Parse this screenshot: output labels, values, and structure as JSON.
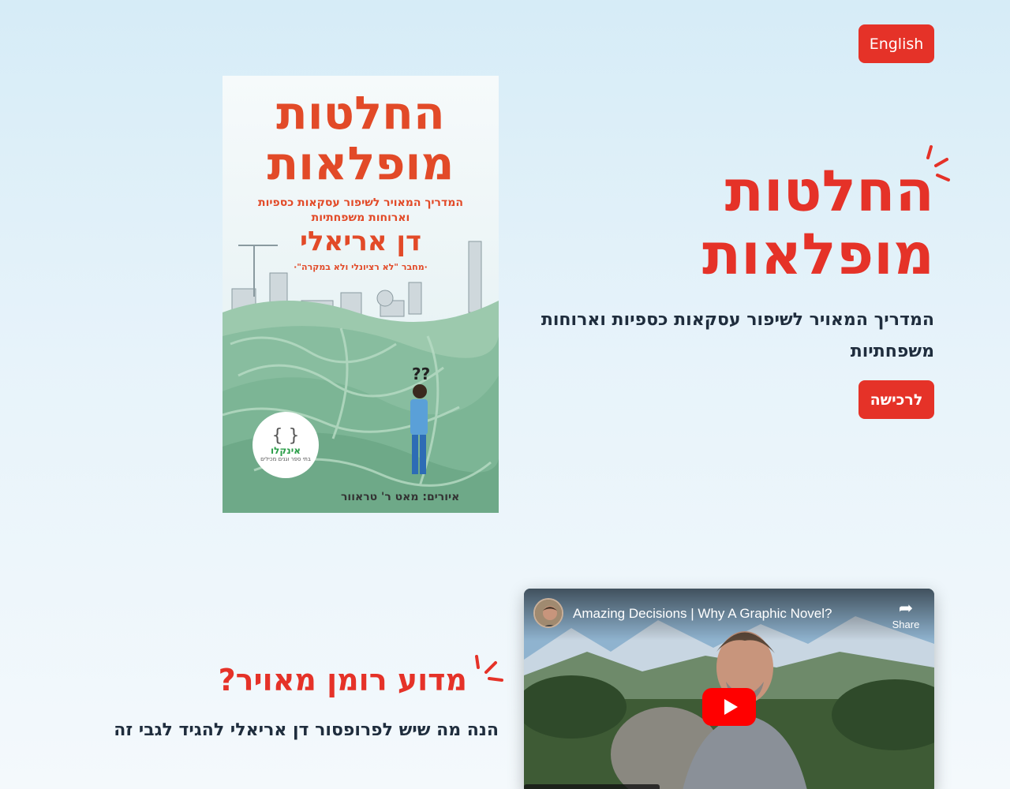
{
  "header": {
    "language_button": "English"
  },
  "book_cover": {
    "title_line1": "החלטות",
    "title_line2": "מופלאות",
    "subtitle": "המדריך המאויר לשיפור עסקאות כספיות וארוחות משפחתיות",
    "author": "דן אריאלי",
    "tagline": "·מחבר \"לא רציונלי ולא במקרה\"·",
    "illustrator": "איורים: מאט ר' טראוור",
    "badge_logo": "אינקלו",
    "badge_sub": "בתי ספר וגנים מכילים",
    "badge_braces": "{ }"
  },
  "hero": {
    "title_line1": "החלטות",
    "title_line2": "מופלאות",
    "subtitle": "המדריך המאויר לשיפור עסקאות כספיות וארוחות משפחתיות",
    "buy_button": "לרכישה"
  },
  "why_section": {
    "title": "מדוע רומן מאויר?",
    "subtitle": "הנה מה שיש לפרופסור דן אריאלי להגיד לגבי זה"
  },
  "video": {
    "title": "Amazing Decisions | Why A Graphic Novel?",
    "share_label": "Share",
    "share_icon": "share-arrow-icon",
    "play_icon": "youtube-play-icon"
  },
  "colors": {
    "accent": "#e53228",
    "text_dark": "#1f2d3d",
    "background_top": "#d6ecf7"
  }
}
